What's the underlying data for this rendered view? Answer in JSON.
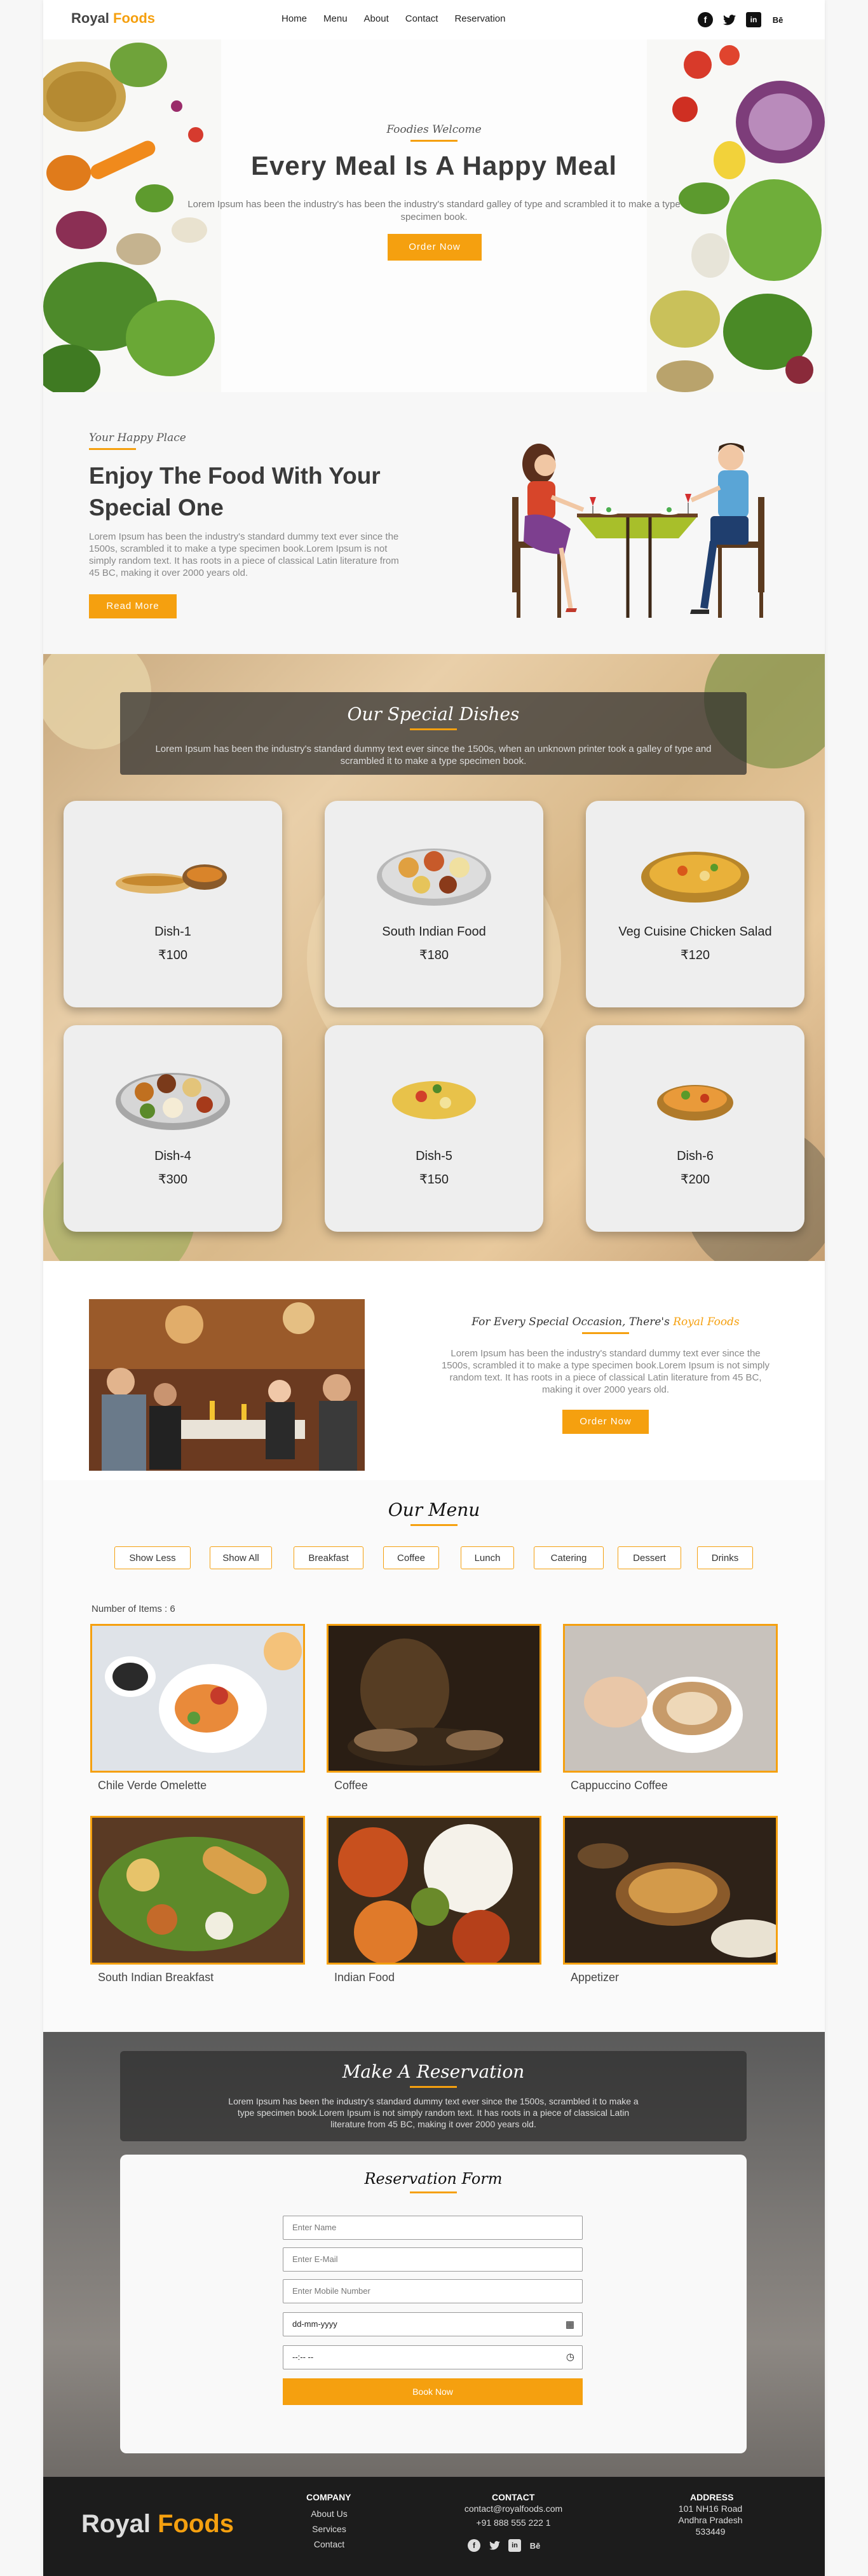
{
  "nav": {
    "brand_part1": "Royal",
    "brand_part2": "Foods",
    "links": [
      "Home",
      "Menu",
      "About",
      "Contact",
      "Reservation"
    ],
    "social": [
      "facebook-icon",
      "twitter-icon",
      "linkedin-icon",
      "behance-icon"
    ],
    "behance_text": "Bē"
  },
  "hero": {
    "eyebrow": "Foodies Welcome",
    "title": "Every Meal Is A Happy Meal",
    "desc": "Lorem Ipsum has been the industry's has been the industry's standard galley of type and scrambled it to make a type specimen book.",
    "button": "Order Now"
  },
  "happy": {
    "eyebrow": "Your Happy Place",
    "title": "Enjoy The Food With Your Special One",
    "desc": "Lorem Ipsum has been the industry's standard dummy text ever since the 1500s, scrambled it to make a type specimen book.Lorem Ipsum is not simply random text. It has roots in a piece of classical Latin literature from 45 BC, making it over 2000 years old.",
    "button": "Read More"
  },
  "special": {
    "title": "Our Special Dishes",
    "desc": "Lorem Ipsum has been the industry's standard dummy text ever since the 1500s, when an unknown printer took a galley of type and scrambled it to make a type specimen book.",
    "dishes": [
      {
        "name": "Dish-1",
        "price": "₹100"
      },
      {
        "name": "South Indian Food",
        "price": "₹180"
      },
      {
        "name": "Veg Cuisine Chicken Salad",
        "price": "₹120"
      },
      {
        "name": "Dish-4",
        "price": "₹300"
      },
      {
        "name": "Dish-5",
        "price": "₹150"
      },
      {
        "name": "Dish-6",
        "price": "₹200"
      }
    ]
  },
  "occasion": {
    "title_part1": "For Every Special Occasion, There's",
    "title_part2": "Royal Foods",
    "desc": "Lorem Ipsum has been the industry's standard dummy text ever since the 1500s, scrambled it to make a type specimen book.Lorem Ipsum is not simply random text. It has roots in a piece of classical Latin literature from 45 BC, making it over 2000 years old.",
    "button": "Order Now"
  },
  "menu": {
    "title": "Our Menu",
    "filters": [
      "Show Less",
      "Show All",
      "Breakfast",
      "Coffee",
      "Lunch",
      "Catering",
      "Dessert",
      "Drinks"
    ],
    "count_text": "Number of Items : 6",
    "items": [
      "Chile Verde Omelette",
      "Coffee",
      "Cappuccino Coffee",
      "South Indian Breakfast",
      "Indian Food",
      "Appetizer"
    ]
  },
  "reservation": {
    "title": "Make A Reservation",
    "desc": "Lorem Ipsum has been the industry's standard dummy text ever since the 1500s, scrambled it to make a type specimen book.Lorem Ipsum is not simply random text. It has roots in a piece of classical Latin literature from 45 BC, making it over 2000 years old.",
    "form_title": "Reservation Form",
    "name_placeholder": "Enter Name",
    "email_placeholder": "Enter E-Mail",
    "mobile_placeholder": "Enter Mobile Number",
    "date_value": "dd-mm-yyyy",
    "time_value": "--:-- --",
    "submit": "Book Now"
  },
  "footer": {
    "brand_part1": "Royal",
    "brand_part2": "Foods",
    "company_heading": "COMPANY",
    "company_links": [
      "About Us",
      "Services",
      "Contact"
    ],
    "contact_heading": "CONTACT",
    "email": "contact@royalfoods.com",
    "phone": "+91 888 555 222 1",
    "address_heading": "ADDRESS",
    "address_lines": [
      "101 NH16 Road",
      "Andhra Pradesh",
      "533449"
    ]
  },
  "colors": {
    "accent": "#f5a00f",
    "dark": "#1c1c1c",
    "text": "#3a3a3a"
  }
}
